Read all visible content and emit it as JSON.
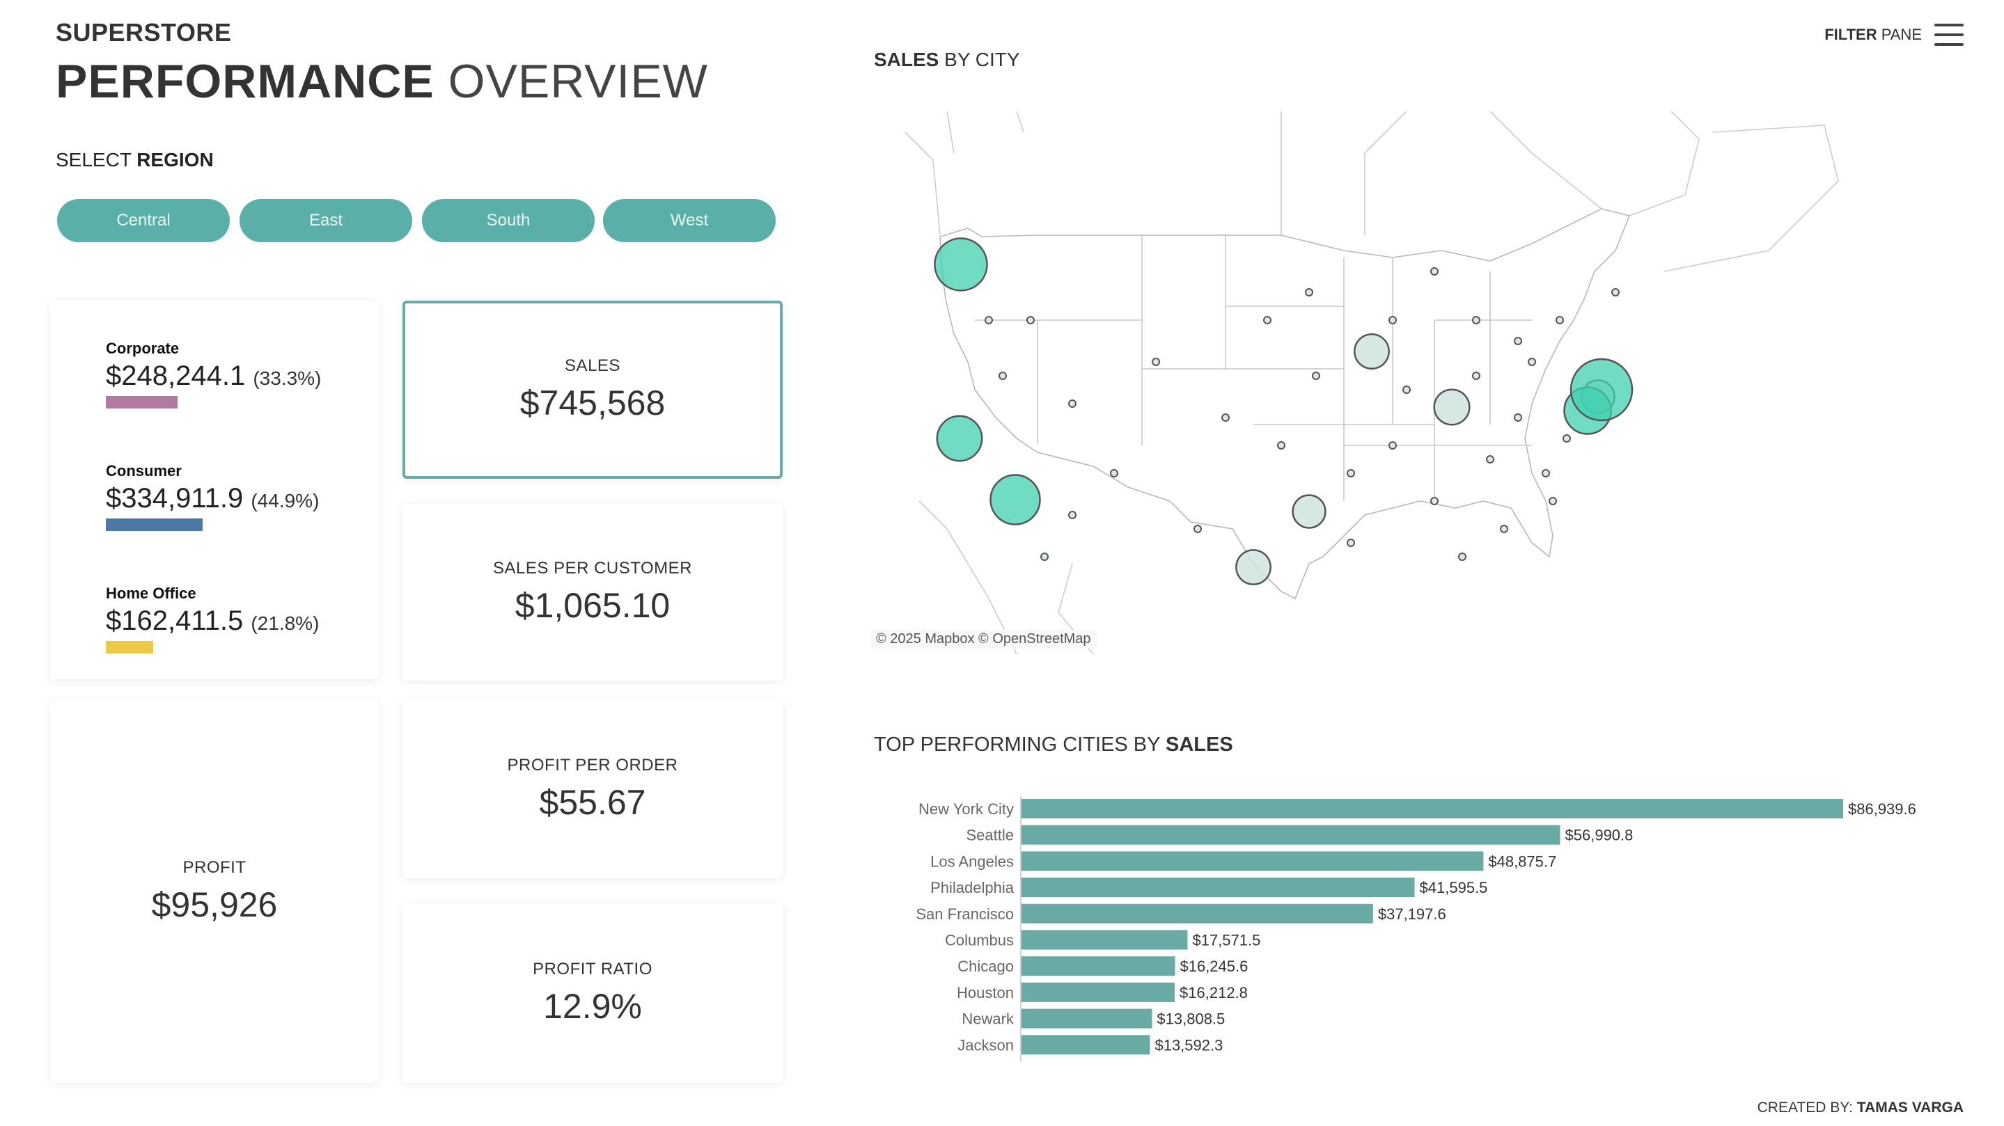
{
  "header": {
    "brand": "SUPERSTORE",
    "title_bold": "PERFORMANCE",
    "title_light": "OVERVIEW"
  },
  "region_selector": {
    "label_light": "SELECT",
    "label_bold": "REGION",
    "options": [
      "Central",
      "East",
      "South",
      "West"
    ],
    "button_color": "#5aafa8"
  },
  "segments": [
    {
      "name": "Corporate",
      "value": "$248,244.1",
      "pct": "(33.3%)",
      "share": 33.3,
      "color": "#b07aa1"
    },
    {
      "name": "Consumer",
      "value": "$334,911.9",
      "pct": "(44.9%)",
      "share": 44.9,
      "color": "#4e79a7"
    },
    {
      "name": "Home Office",
      "value": "$162,411.5",
      "pct": "(21.8%)",
      "share": 21.8,
      "color": "#edc948"
    }
  ],
  "kpis": {
    "sales": {
      "label": "SALES",
      "value": "$745,568"
    },
    "sales_per_customer": {
      "label": "SALES PER CUSTOMER",
      "value": "$1,065.10"
    },
    "profit": {
      "label": "PROFIT",
      "value": "$95,926"
    },
    "profit_per_order": {
      "label": "PROFIT PER ORDER",
      "value": "$55.67"
    },
    "profit_ratio": {
      "label": "PROFIT RATIO",
      "value": "12.9%"
    }
  },
  "filter_pane": {
    "bold": "FILTER",
    "light": "PANE",
    "icon": "hamburger-menu-icon"
  },
  "map": {
    "title_bold": "SALES",
    "title_light": "BY CITY",
    "attribution": "© 2025 Mapbox © OpenStreetMap",
    "highlight_color": "#40d0b0",
    "cities": [
      {
        "name": "New York City",
        "sales": 86939.6,
        "top": true
      },
      {
        "name": "Seattle",
        "sales": 56990.8,
        "top": true
      },
      {
        "name": "Los Angeles",
        "sales": 48875.7,
        "top": true
      },
      {
        "name": "Philadelphia",
        "sales": 41595.5,
        "top": true
      },
      {
        "name": "San Francisco",
        "sales": 37197.6,
        "top": true
      },
      {
        "name": "Columbus",
        "sales": 17571.5,
        "top": false
      },
      {
        "name": "Chicago",
        "sales": 16245.6,
        "top": false
      },
      {
        "name": "Houston",
        "sales": 16212.8,
        "top": false
      },
      {
        "name": "Newark",
        "sales": 13808.5,
        "top": false
      },
      {
        "name": "Jackson",
        "sales": 13592.3,
        "top": false
      }
    ]
  },
  "chart_data": {
    "type": "bar",
    "orientation": "horizontal",
    "title": "TOP PERFORMING CITIES BY SALES",
    "categories": [
      "New York City",
      "Seattle",
      "Los Angeles",
      "Philadelphia",
      "San Francisco",
      "Columbus",
      "Chicago",
      "Houston",
      "Newark",
      "Jackson"
    ],
    "values": [
      86939.6,
      56990.8,
      48875.7,
      41595.5,
      37197.6,
      17571.5,
      16245.6,
      16212.8,
      13808.5,
      13592.3
    ],
    "labels": [
      "$86,939.6",
      "$56,990.8",
      "$48,875.7",
      "$41,595.5",
      "$37,197.6",
      "$17,571.5",
      "$16,245.6",
      "$16,212.8",
      "$13,808.5",
      "$13,592.3"
    ],
    "xlabel": "",
    "ylabel": "",
    "xlim": [
      0,
      86939.6
    ],
    "grid": false,
    "bar_color": "#6aaaa5"
  },
  "footer": {
    "prefix": "CREATED BY:",
    "author": "TAMAS VARGA"
  }
}
